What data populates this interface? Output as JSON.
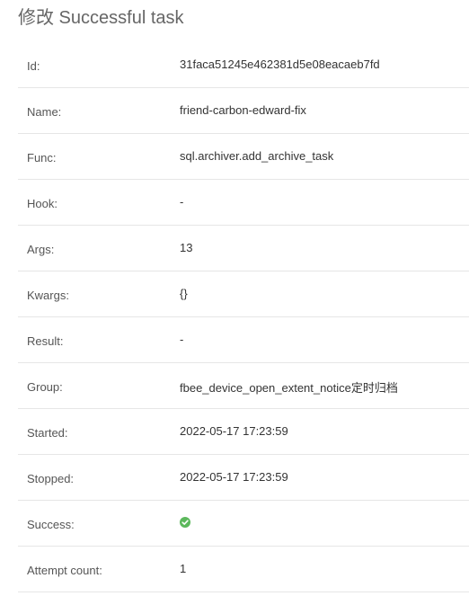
{
  "header": {
    "title": "修改 Successful task"
  },
  "fields": {
    "id": {
      "label": "Id:",
      "value": "31faca51245e462381d5e08eacaeb7fd"
    },
    "name": {
      "label": "Name:",
      "value": "friend-carbon-edward-fix"
    },
    "func": {
      "label": "Func:",
      "value": "sql.archiver.add_archive_task"
    },
    "hook": {
      "label": "Hook:",
      "value": "-"
    },
    "args": {
      "label": "Args:",
      "value": "13"
    },
    "kwargs": {
      "label": "Kwargs:",
      "value": "{}"
    },
    "result": {
      "label": "Result:",
      "value": "-"
    },
    "group": {
      "label": "Group:",
      "value": "fbee_device_open_extent_notice定时归档"
    },
    "started": {
      "label": "Started:",
      "value": "2022-05-17 17:23:59"
    },
    "stopped": {
      "label": "Stopped:",
      "value": "2022-05-17 17:23:59"
    },
    "success": {
      "label": "Success:",
      "icon": "check-circle-icon",
      "icon_color": "#5cb85c"
    },
    "attempt_count": {
      "label": "Attempt count:",
      "value": "1"
    }
  }
}
